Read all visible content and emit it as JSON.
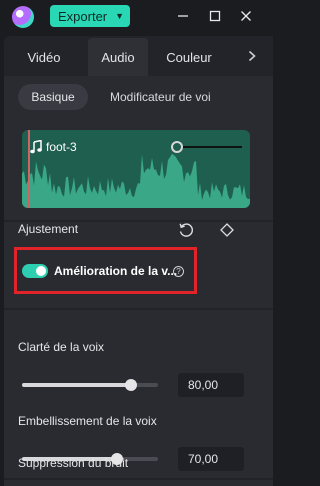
{
  "app": {
    "export_label": "Exporter",
    "brand_color": "#29d7b4"
  },
  "tabs": [
    {
      "label": "Vidéo",
      "active": false
    },
    {
      "label": "Audio",
      "active": true
    },
    {
      "label": "Couleur",
      "active": false
    }
  ],
  "subtabs": [
    {
      "label": "Basique",
      "active": true
    },
    {
      "label": "Modificateur de voi",
      "active": false
    }
  ],
  "clip": {
    "name": "foot-3",
    "icon": "music-note-icon",
    "waveform_color": "#3aa886"
  },
  "adjust": {
    "title": "Ajustement",
    "reset_icon": "reset-icon",
    "keyframe_icon": "diamond-icon"
  },
  "enhancement": {
    "label": "Amélioration de la v...",
    "enabled": true,
    "help_icon": "help-icon"
  },
  "params": [
    {
      "label": "Clarté de la voix",
      "value": "80,00",
      "level": 0.8
    },
    {
      "label": "Embellissement de la voix",
      "value": "70,00",
      "level": 0.7
    }
  ],
  "noise": {
    "label": "Suppression du bruit"
  },
  "highlight_color": "#e0242a"
}
